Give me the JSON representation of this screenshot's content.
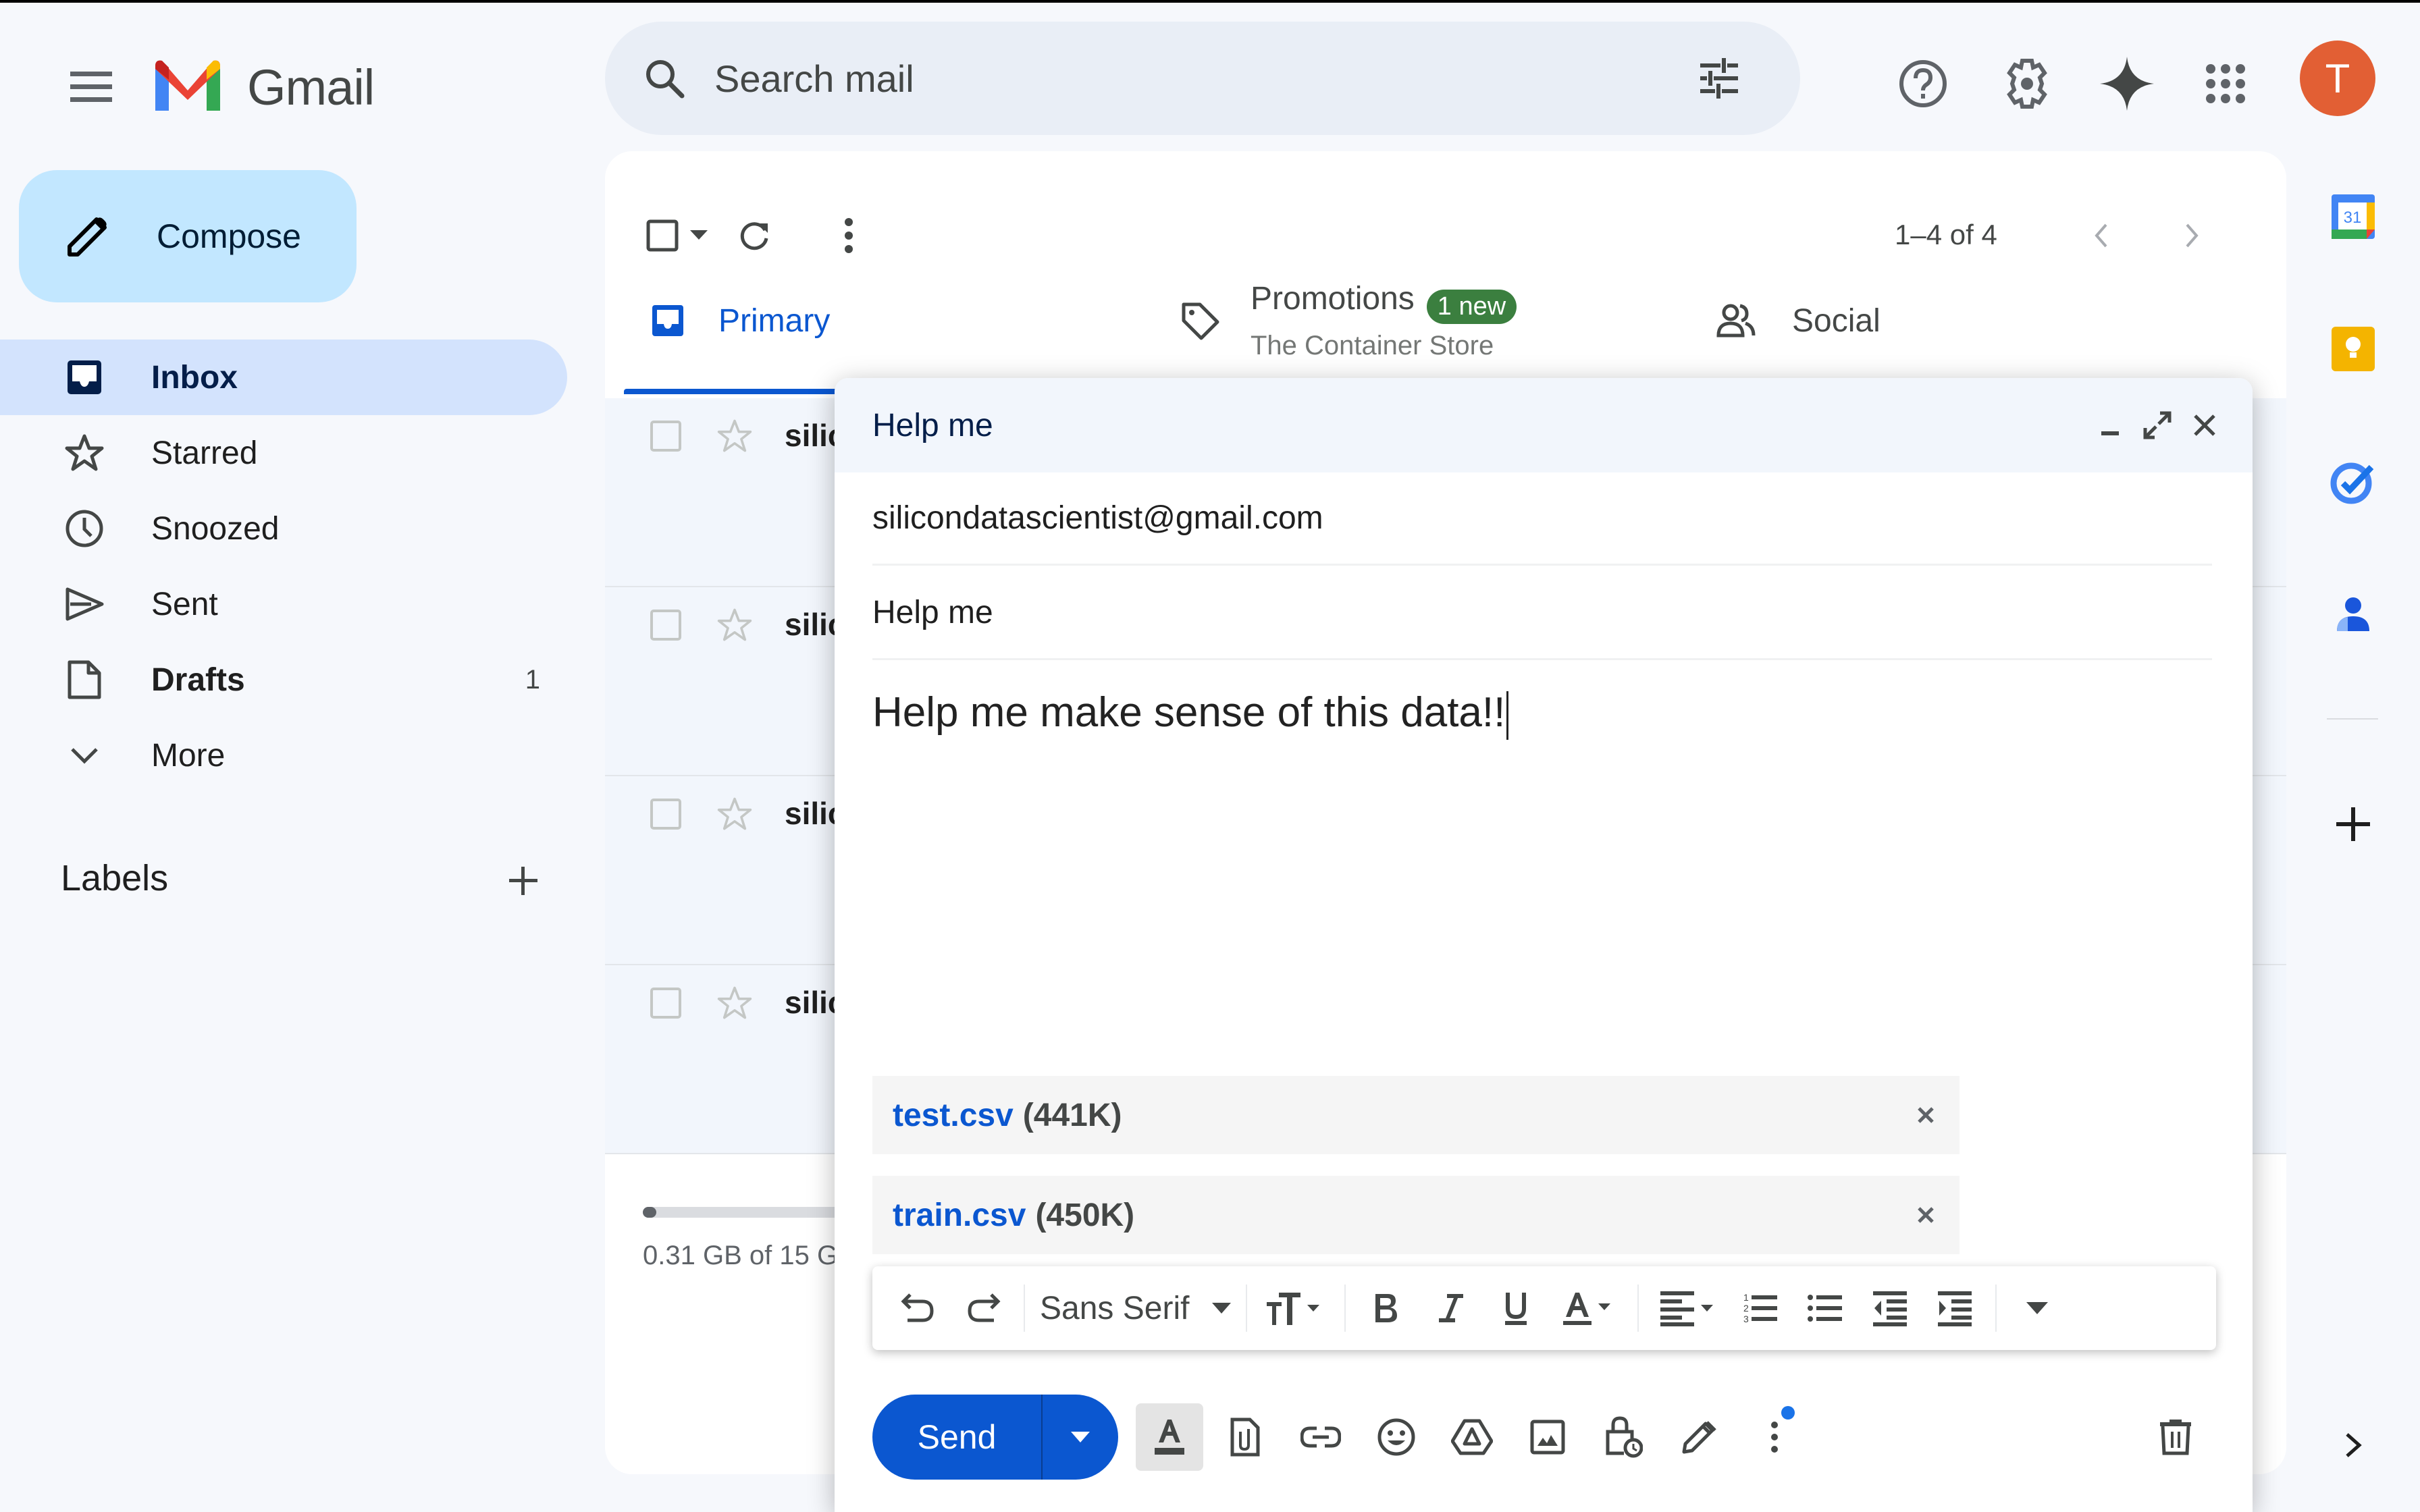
{
  "app": {
    "name": "Gmail",
    "brand_colors": {
      "red": "#ea4335",
      "blue": "#4285f4",
      "yellow": "#fbbc04",
      "green": "#34a853",
      "accent": "#0b57d0",
      "avatar": "#e25f34"
    }
  },
  "header": {
    "search_placeholder": "Search mail",
    "icons": [
      "main-menu-icon",
      "search-icon",
      "search-options-icon",
      "help-icon",
      "settings-icon",
      "gemini-icon",
      "apps-grid-icon"
    ],
    "avatar_initial": "T"
  },
  "sidebar": {
    "compose_label": "Compose",
    "items": [
      {
        "label": "Inbox",
        "icon": "inbox-icon",
        "active": true,
        "count": ""
      },
      {
        "label": "Starred",
        "icon": "star-icon",
        "active": false,
        "count": ""
      },
      {
        "label": "Snoozed",
        "icon": "clock-icon",
        "active": false,
        "count": ""
      },
      {
        "label": "Sent",
        "icon": "send-icon",
        "active": false,
        "count": ""
      },
      {
        "label": "Drafts",
        "icon": "draft-icon",
        "active": false,
        "count": "1",
        "bold": true
      },
      {
        "label": "More",
        "icon": "chevron-down-icon",
        "active": false,
        "count": ""
      }
    ],
    "labels_heading": "Labels"
  },
  "mail_list": {
    "pager": "1–4 of 4",
    "tabs": [
      {
        "label": "Primary",
        "icon": "inbox-icon",
        "active": true
      },
      {
        "label": "Promotions",
        "icon": "tag-icon",
        "active": false,
        "badge": "1 new",
        "subtitle": "The Container Store"
      },
      {
        "label": "Social",
        "icon": "people-icon",
        "active": false
      }
    ],
    "rows": [
      {
        "sender": "silic"
      },
      {
        "sender": "silic"
      },
      {
        "sender": "silic"
      },
      {
        "sender": "silic"
      }
    ],
    "storage": {
      "text": "0.31 GB of 15 G",
      "used_fraction": 0.021
    }
  },
  "compose_window": {
    "title": "Help me",
    "to": "silicondatascientist@gmail.com",
    "subject": "Help me",
    "body": "Help me make sense of this data!!",
    "attachments": [
      {
        "name": "test.csv",
        "size": "(441K)"
      },
      {
        "name": "train.csv",
        "size": "(450K)"
      }
    ],
    "formatting": {
      "font": "Sans Serif"
    },
    "send_label": "Send"
  }
}
